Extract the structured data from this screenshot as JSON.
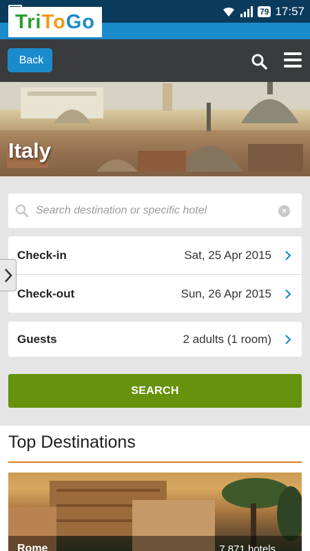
{
  "status_bar": {
    "battery": "79",
    "time": "17:57"
  },
  "logo": {
    "part1": "Tri",
    "part2": "To",
    "part3": "Go"
  },
  "nav": {
    "back_label": "Back"
  },
  "hero": {
    "title": "Italy"
  },
  "search": {
    "placeholder": "Search destination or specific hotel",
    "value": ""
  },
  "booking": {
    "checkin_label": "Check-in",
    "checkin_value": "Sat, 25 Apr 2015",
    "checkout_label": "Check-out",
    "checkout_value": "Sun, 26 Apr 2015",
    "guests_label": "Guests",
    "guests_value": "2 adults (1 room)",
    "search_button": "SEARCH"
  },
  "top_destinations": {
    "title": "Top Destinations",
    "items": [
      {
        "name": "Rome",
        "count": "7,871 hotels"
      }
    ]
  },
  "colors": {
    "accent": "#1a8ccc",
    "search_button": "#67920e",
    "divider": "#e07a1f",
    "nav_bar": "#3a3b3c"
  }
}
